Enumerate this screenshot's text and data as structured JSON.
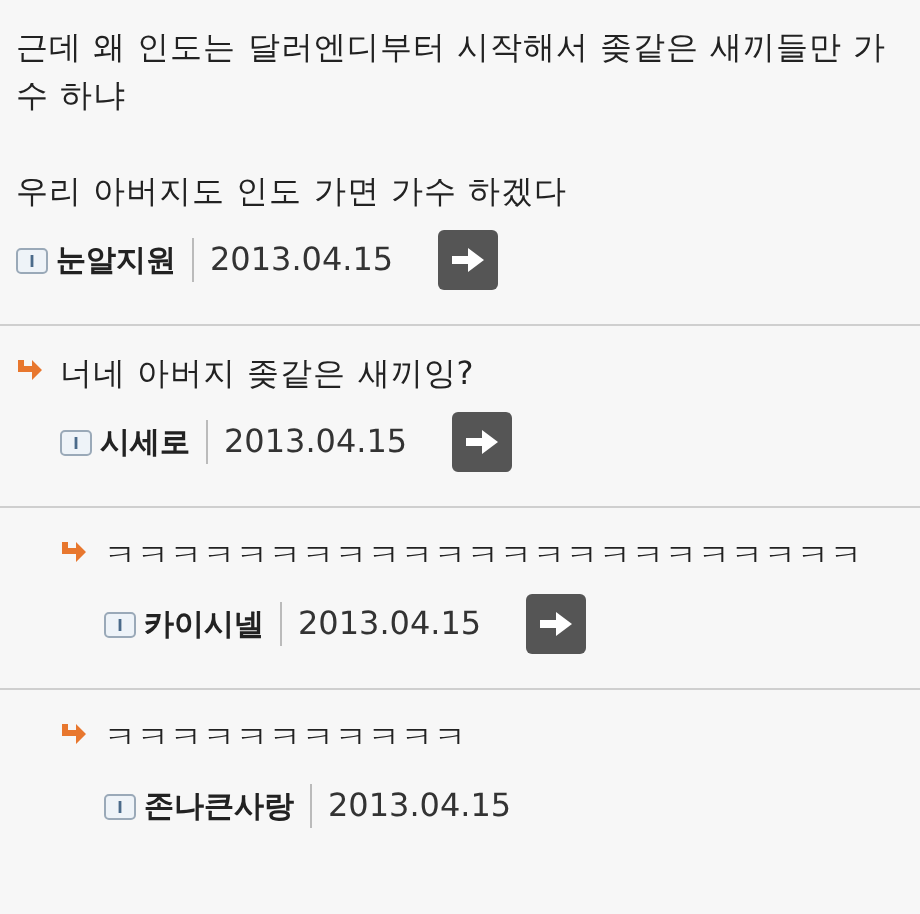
{
  "comments": [
    {
      "paragraphs": [
        "근데 왜 인도는 달러엔디부터 시작해서 좆같은 새끼들만 가수 하냐",
        "우리 아버지도 인도 가면 가수 하겠다"
      ],
      "author": "눈알지원",
      "date": "2013.04.15",
      "reply_button": true,
      "children": [
        {
          "paragraphs": [
            "너네 아버지 좆같은 새끼잉?"
          ],
          "author": "시세로",
          "date": "2013.04.15",
          "reply_button": true,
          "children": [
            {
              "paragraphs": [
                "ㅋㅋㅋㅋㅋㅋㅋㅋㅋㅋㅋㅋㅋㅋㅋㅋㅋㅋㅋㅋㅋㅋㅋ"
              ],
              "author": "카이시넬",
              "date": "2013.04.15",
              "reply_button": true
            },
            {
              "paragraphs": [
                "ㅋㅋㅋㅋㅋㅋㅋㅋㅋㅋㅋ"
              ],
              "author": "존나큰사랑",
              "date": "2013.04.15",
              "reply_button": false
            }
          ]
        }
      ]
    }
  ]
}
